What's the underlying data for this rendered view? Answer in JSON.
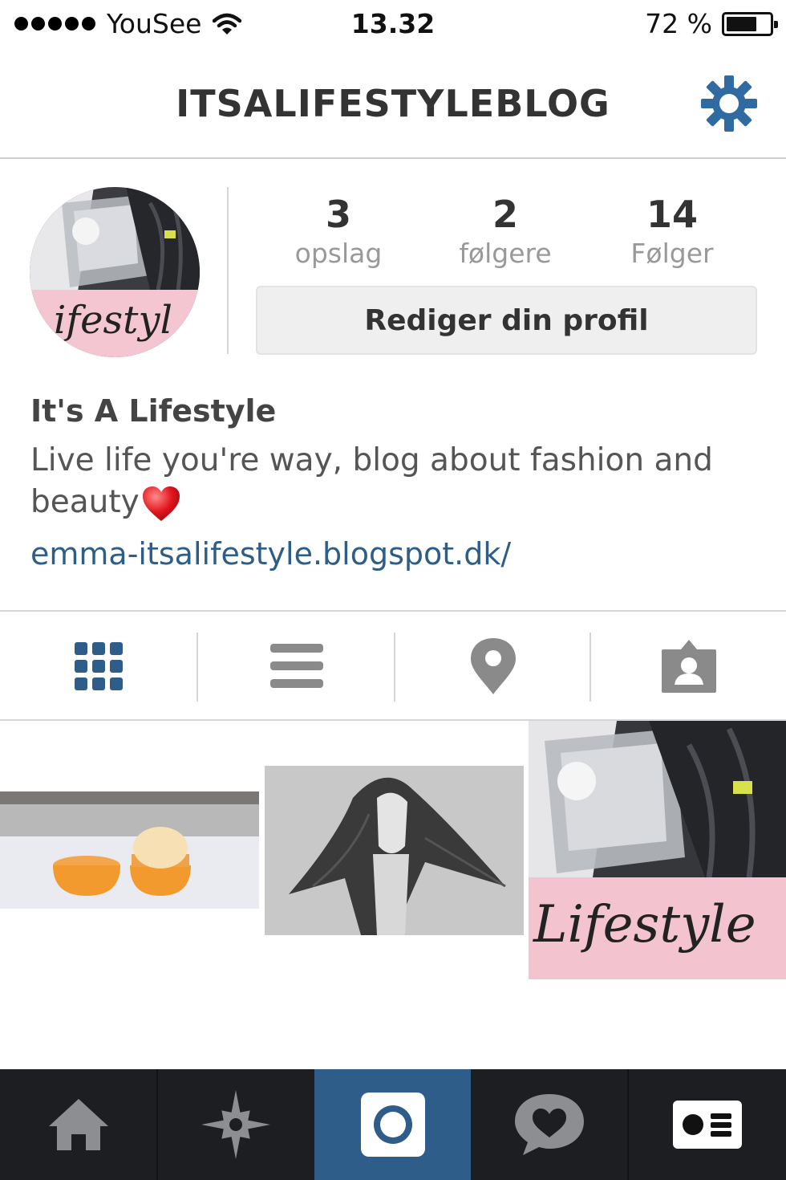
{
  "status_bar": {
    "carrier": "YouSee",
    "time": "13.32",
    "battery": "72 %",
    "battery_level": 0.72
  },
  "header": {
    "title": "ITSALIFESTYLEBLOG"
  },
  "profile": {
    "avatar_text": "ifestyl",
    "stats": [
      {
        "value": "3",
        "label": "opslag"
      },
      {
        "value": "2",
        "label": "følgere"
      },
      {
        "value": "14",
        "label": "Følger"
      }
    ],
    "edit_button": "Rediger din profil",
    "name": "It's A Lifestyle",
    "bio": "Live life you're way, blog about fashion and beauty",
    "website": "emma-itsalifestyle.blogspot.dk/"
  },
  "tabs": [
    "grid-icon",
    "list-icon",
    "location-pin-icon",
    "tagged-person-icon"
  ],
  "grid": {
    "photo3_text": "Lifestyle"
  },
  "bottom_nav": [
    "home-icon",
    "explore-icon",
    "camera-icon",
    "activity-icon",
    "profile-icon"
  ],
  "colors": {
    "accent": "#2f5d8a",
    "link": "#2e5e86",
    "nav_bg": "#1c1e21",
    "gear": "#2f6aa0"
  }
}
